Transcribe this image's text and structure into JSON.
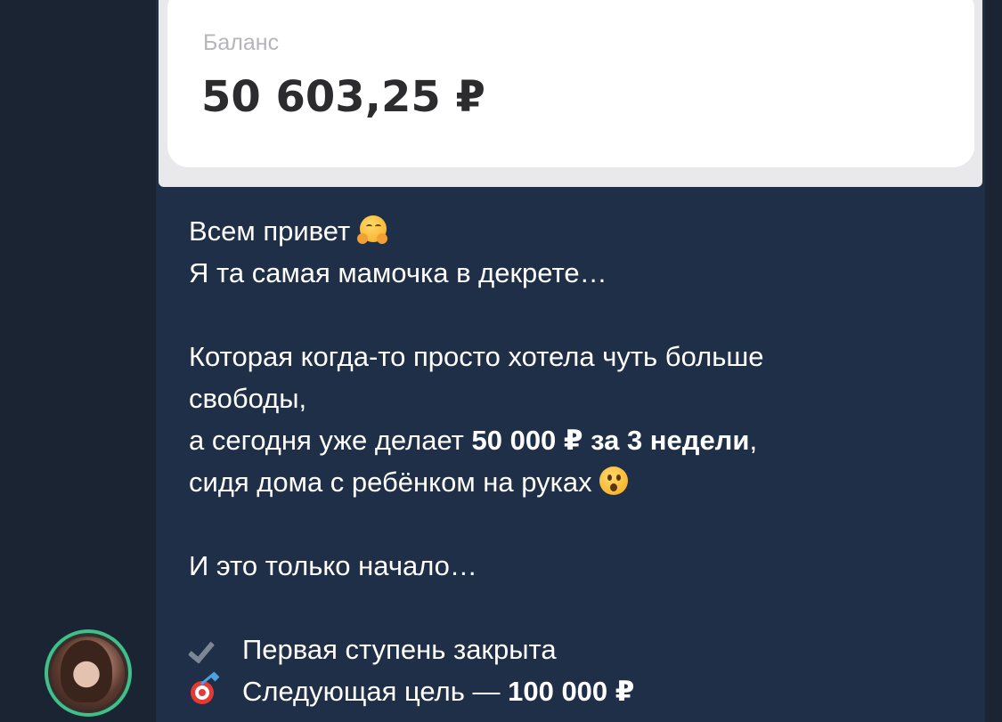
{
  "balance_card": {
    "label": "Баланс",
    "value": "50 603,25 ₽"
  },
  "message": {
    "line1": "Всем привет",
    "line2": "Я та самая мамочка в декрете…",
    "line3": "Которая когда-то просто хотела чуть больше",
    "line4": "свободы,",
    "line5_prefix": "а сегодня уже делает ",
    "line5_bold": "50 000 ₽ за 3 недели",
    "line5_suffix": ",",
    "line6": "сидя дома с ребёнком на руках",
    "line7": "И это только начало…",
    "item1_prefix": "Первая ступень закрыта",
    "item2_prefix": "Следующая цель — ",
    "item2_bold": "100 000 ₽"
  },
  "icons": {
    "line1_emoji": "hugging-face-icon",
    "line6_emoji": "astonished-face-icon",
    "item1_icon": "check-mark-icon",
    "item2_icon": "direct-hit-target-icon"
  },
  "colors": {
    "background": "#1a2433",
    "bubble": "#1f2f47",
    "avatar_ring": "#3fc08a"
  }
}
